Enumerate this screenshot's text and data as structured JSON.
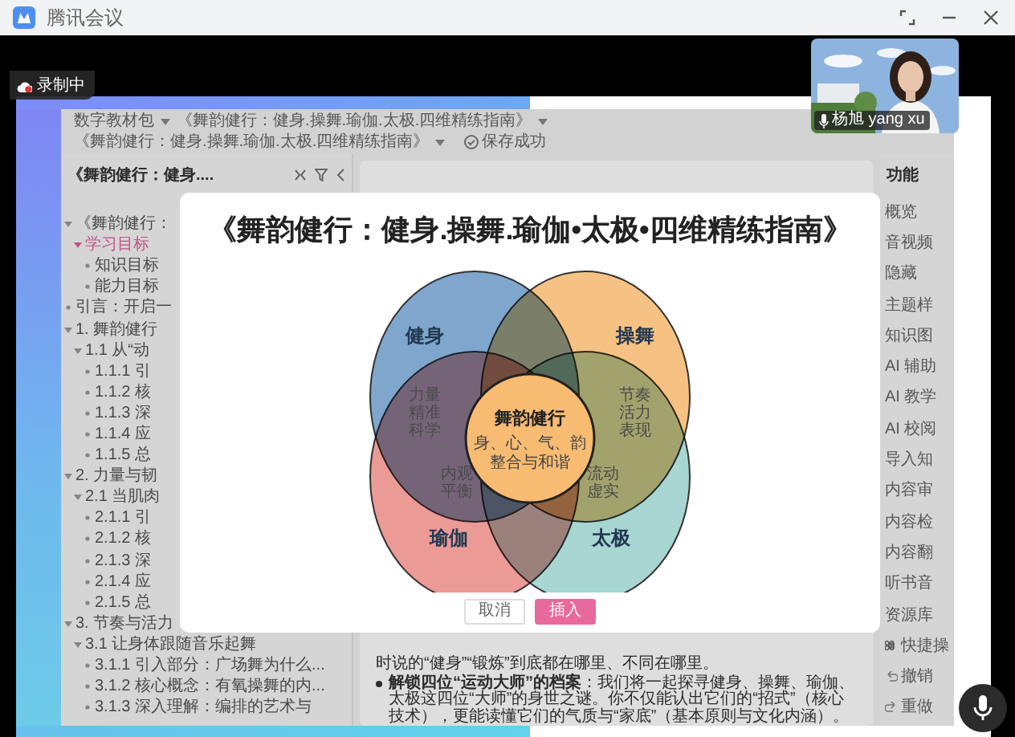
{
  "window": {
    "title": "腾讯会议"
  },
  "recording": {
    "label": "录制中"
  },
  "video_tile": {
    "name": "杨旭 yang xu"
  },
  "editor": {
    "breadcrumb": [
      "数字教材包",
      "《舞韵健行：健身.操舞.瑜伽.太极.四维精练指南》",
      "《舞韵健行：健身.操舞.瑜伽.太极.四维精练指南》"
    ],
    "save_status": "保存成功",
    "outline": {
      "title": "《舞韵健行：健身....",
      "items": [
        {
          "label": "《舞韵健行：",
          "selected": false,
          "children": [
            {
              "label": "学习目标",
              "selected": true,
              "children": [
                {
                  "label": "知识目标",
                  "selected": false
                },
                {
                  "label": "能力目标",
                  "selected": false
                }
              ]
            }
          ]
        },
        {
          "label": "引言：开启一",
          "selected": false
        },
        {
          "label": "1. 舞韵健行",
          "selected": false,
          "children": [
            {
              "label": "1.1 从“动",
              "selected": false,
              "children": [
                {
                  "label": "1.1.1 引",
                  "selected": false
                },
                {
                  "label": "1.1.2 核",
                  "selected": false
                },
                {
                  "label": "1.1.3 深",
                  "selected": false
                },
                {
                  "label": "1.1.4 应",
                  "selected": false
                },
                {
                  "label": "1.1.5 总",
                  "selected": false
                }
              ]
            }
          ]
        },
        {
          "label": "2. 力量与韧",
          "selected": false,
          "children": [
            {
              "label": "2.1 当肌肉",
              "selected": false,
              "children": [
                {
                  "label": "2.1.1 引",
                  "selected": false
                },
                {
                  "label": "2.1.2 核",
                  "selected": false
                },
                {
                  "label": "2.1.3 深",
                  "selected": false
                },
                {
                  "label": "2.1.4 应",
                  "selected": false
                },
                {
                  "label": "2.1.5 总",
                  "selected": false
                }
              ]
            }
          ]
        },
        {
          "label": "3. 节奏与活力",
          "selected": false,
          "children": [
            {
              "label": "3.1 让身体跟随音乐起舞",
              "selected": false,
              "children": [
                {
                  "label": "3.1.1 引入部分：广场舞为什么...",
                  "selected": false
                },
                {
                  "label": "3.1.2 核心概念：有氧操舞的内...",
                  "selected": false
                },
                {
                  "label": "3.1.3 深入理解：编排的艺术与",
                  "selected": false
                }
              ]
            }
          ]
        }
      ]
    },
    "content": [
      {
        "kind": "text",
        "text": "时说的“健身”“锻炼”到底都在哪里、不同在哪里。"
      },
      {
        "kind": "bullet",
        "text": "**解锁四位“运动大师”的档案**：我们将一起探寻健身、操舞、瑜伽、太极这四位“大师”的身世之谜。你不仅能认出它们的“招式”（核心技术），更能读懂它们的气质与“家底”（基本原则与文化内涵）。"
      }
    ],
    "function_panel": {
      "title": "功能",
      "items": [
        {
          "label": "概览",
          "kind": "plain"
        },
        {
          "label": "音视频",
          "kind": "plain"
        },
        {
          "label": "隐藏",
          "kind": "plain"
        },
        {
          "label": "主题样",
          "kind": "plain"
        },
        {
          "label": "知识图",
          "kind": "plain"
        },
        {
          "label": "AI 辅助",
          "kind": "plain"
        },
        {
          "label": "AI 教学",
          "kind": "plain"
        },
        {
          "label": "AI 校阅",
          "kind": "plain"
        },
        {
          "label": "导入知",
          "kind": "plain"
        },
        {
          "label": "内容审",
          "kind": "plain"
        },
        {
          "label": "内容检",
          "kind": "plain"
        },
        {
          "label": "内容翻",
          "kind": "plain"
        },
        {
          "label": "听书音",
          "kind": "plain"
        },
        {
          "label": "资源库",
          "kind": "plain"
        },
        {
          "label": "快捷操",
          "kind": "shortcut"
        },
        {
          "label": "撤销",
          "kind": "undo"
        },
        {
          "label": "重做",
          "kind": "redo"
        }
      ]
    }
  },
  "dialog": {
    "title": "《舞韵健行：健身.操舞.瑜伽•太极•四维精练指南》",
    "venn": {
      "sets": [
        {
          "label": "健身",
          "color": "#7fa6cc",
          "terms": [
            "力量",
            "精准",
            "科学"
          ]
        },
        {
          "label": "操舞",
          "color": "#f6c283",
          "terms": [
            "节奏",
            "活力",
            "表现"
          ]
        },
        {
          "label": "瑜伽",
          "color": "#eb9a96",
          "terms": [
            "内观",
            "平衡"
          ]
        },
        {
          "label": "太极",
          "color": "#a8d6d2",
          "terms": [
            "流动",
            "虚实"
          ]
        }
      ],
      "center": {
        "label": "舞韵健行",
        "lines": [
          "身、心、气、韵",
          "整合与和谐"
        ]
      }
    },
    "buttons": [
      {
        "label": "取消",
        "kind": "secondary"
      },
      {
        "label": "插入",
        "kind": "primary"
      }
    ]
  }
}
